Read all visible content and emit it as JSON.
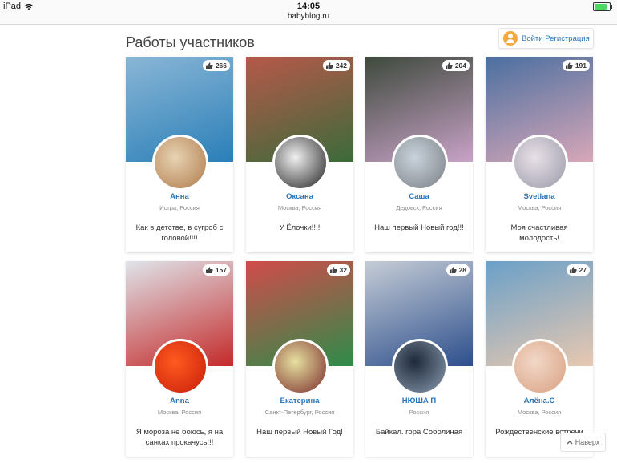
{
  "statusbar": {
    "device": "iPad",
    "time": "14:05",
    "url": "babyblog.ru",
    "battery_level": 0.85,
    "battery_color": "#4cd964"
  },
  "header": {
    "title": "Работы участников",
    "login_label": "Войти Регистрация"
  },
  "cards": [
    {
      "likes": "266",
      "name": "Анна",
      "location": "Истра, Россия",
      "description": "Как в детстве, в сугроб с головой!!!!",
      "photo_colors": [
        "#8ab6d6",
        "#2a7fb8"
      ],
      "avatar_colors": [
        "#e7d3b3",
        "#b07a4a"
      ]
    },
    {
      "likes": "242",
      "name": "Оксана",
      "location": "Москва, Россия",
      "description": "У Ёлочки!!!!",
      "photo_colors": [
        "#b7584a",
        "#3b6b3a"
      ],
      "avatar_colors": [
        "#f0f0f0",
        "#222222"
      ]
    },
    {
      "likes": "204",
      "name": "Саша",
      "location": "Дедовск, Россия",
      "description": "Наш первый Новый год!!!",
      "photo_colors": [
        "#3e4a3c",
        "#c8a2c8"
      ],
      "avatar_colors": [
        "#c9d3db",
        "#7b7f86"
      ]
    },
    {
      "likes": "191",
      "name": "Svetlana",
      "location": "Москва, Россия",
      "description": "Моя счастливая молодость!",
      "photo_colors": [
        "#4a6fa0",
        "#d8a7b8"
      ],
      "avatar_colors": [
        "#e8e0e8",
        "#9a9aa8"
      ]
    },
    {
      "likes": "157",
      "name": "Anna",
      "location": "Москва, Россия",
      "description": "Я мороза не боюсь, я на санках прокачусь!!!",
      "photo_colors": [
        "#dfe4ea",
        "#c42a2a"
      ],
      "avatar_colors": [
        "#ff5a1f",
        "#c81e0a"
      ]
    },
    {
      "likes": "32",
      "name": "Екатерина",
      "location": "Санкт-Петербург, Россия",
      "description": "Наш первый Новый Год!",
      "photo_colors": [
        "#d24b4b",
        "#2d8c4a"
      ],
      "avatar_colors": [
        "#e6e0a0",
        "#7a2a2a"
      ]
    },
    {
      "likes": "28",
      "name": "НЮША П",
      "location": "Россия",
      "description": "Байкал. гора Соболиная",
      "photo_colors": [
        "#c5ccd6",
        "#2d4f8c"
      ],
      "avatar_colors": [
        "#1e2a3a",
        "#8a9bb0"
      ]
    },
    {
      "likes": "27",
      "name": "Алёна.С",
      "location": "Москва, Россия",
      "description": "Рождественские встречи",
      "photo_colors": [
        "#6aa0c8",
        "#e8c8b0"
      ],
      "avatar_colors": [
        "#f2d8c8",
        "#d8a080"
      ]
    }
  ],
  "back_to_top": {
    "label": "Наверх"
  }
}
